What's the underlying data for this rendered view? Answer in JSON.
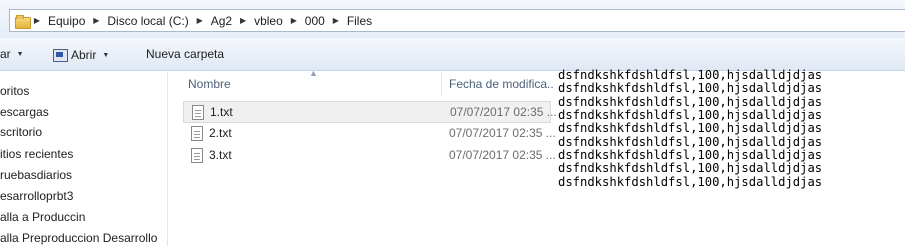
{
  "address_bar": {
    "crumbs": [
      "Equipo",
      "Disco local (C:)",
      "Ag2",
      "vbleo",
      "000",
      "Files"
    ]
  },
  "toolbar": {
    "organize_label": "ar",
    "open_label": "Abrir",
    "new_folder_label": "Nueva carpeta"
  },
  "nav_pane": {
    "items": [
      "oritos",
      "escargas",
      "scritorio",
      "itios recientes",
      "ruebasdiarios",
      "esarrolloprbt3",
      "alla a Produccin",
      "alla Preproduccion Desarrollo"
    ]
  },
  "file_list": {
    "columns": {
      "name": "Nombre",
      "date": "Fecha de modifica..."
    },
    "files": [
      {
        "name": "1.txt",
        "date": "07/07/2017 02:35 ...",
        "selected": true
      },
      {
        "name": "2.txt",
        "date": "07/07/2017 02:35 ...",
        "selected": false
      },
      {
        "name": "3.txt",
        "date": "07/07/2017 02:35 ...",
        "selected": false
      }
    ]
  },
  "console": {
    "lines": [
      "dsfndkshkfdshldfsl,100,hjsdalldjdjas",
      "dsfndkshkfdshldfsl,100,hjsdalldjdjas",
      "dsfndkshkfdshldfsl,100,hjsdalldjdjas",
      "dsfndkshkfdshldfsl,100,hjsdalldjdjas",
      "dsfndkshkfdshldfsl,100,hjsdalldjdjas",
      "dsfndkshkfdshldfsl,100,hjsdalldjdjas",
      "dsfndkshkfdshldfsl,100,hjsdalldjdjas",
      "dsfndkshkfdshldfsl,100,hjsdalldjdjas",
      "dsfndkshkfdshldfsl,100,hjsdalldjdjas"
    ]
  },
  "icons": {
    "folder": "folder-icon",
    "open": "open-program-icon",
    "file": "text-file-icon",
    "breadcrumb_separator": "chevron-right-icon",
    "dropdown": "chevron-down-icon",
    "sort": "sort-ascending-icon"
  },
  "colors": {
    "toolbar_bg": "#dfe8f4",
    "selection_bg": "#f0f0f0",
    "header_text": "#4c607a",
    "date_text": "#6d6d6d"
  }
}
